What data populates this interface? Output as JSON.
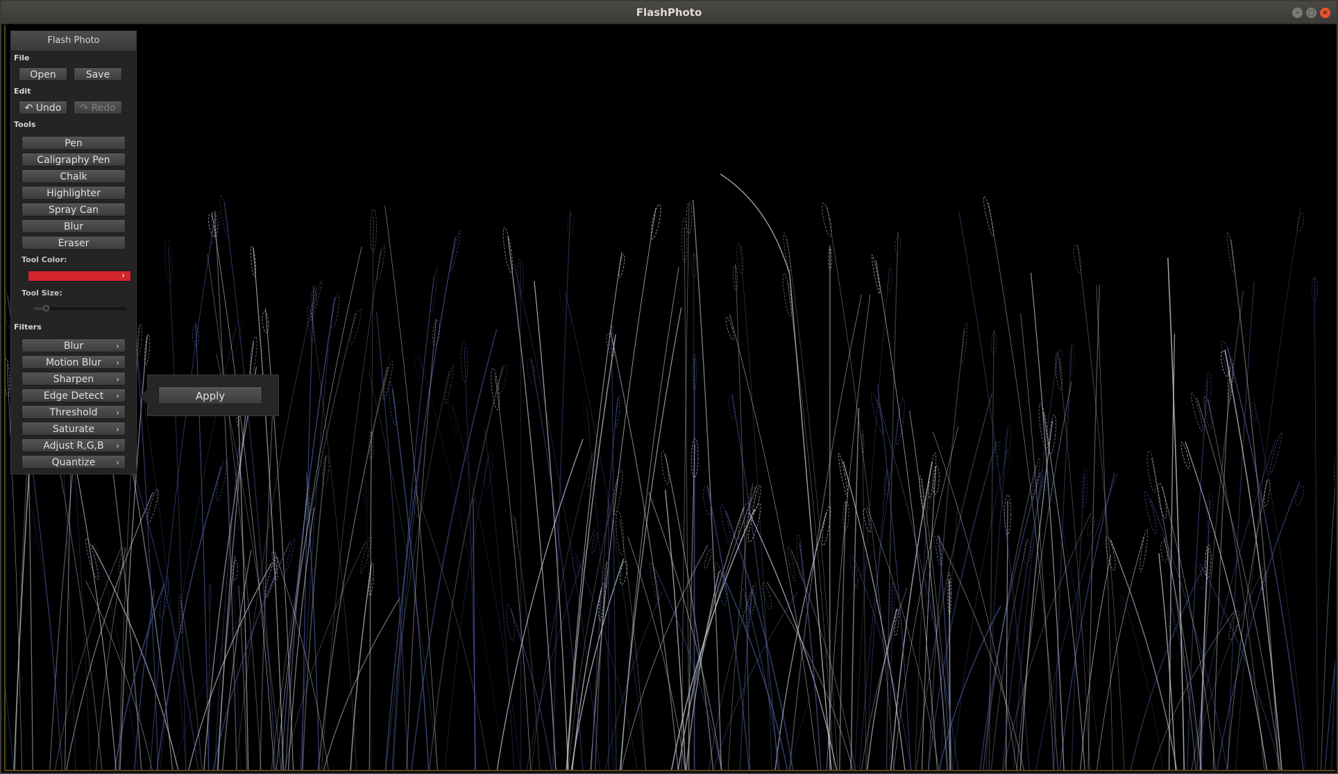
{
  "window": {
    "title": "FlashPhoto",
    "controls": {
      "minimize": "–",
      "maximize": "□",
      "close": "×"
    }
  },
  "panel": {
    "header": "Flash Photo",
    "file_label": "File",
    "open_label": "Open",
    "save_label": "Save",
    "edit_label": "Edit",
    "undo_label": "Undo",
    "redo_label": "Redo",
    "undo_icon": "↶",
    "redo_icon": "↷",
    "tools_label": "Tools",
    "tools": [
      "Pen",
      "Caligraphy Pen",
      "Chalk",
      "Highlighter",
      "Spray Can",
      "Blur",
      "Eraser"
    ],
    "tool_color_label": "Tool Color:",
    "tool_color": "#d1252b",
    "tool_size_label": "Tool Size:",
    "tool_size_fraction": 0.13,
    "filters_label": "Filters",
    "filters": [
      "Blur",
      "Motion Blur",
      "Sharpen",
      "Edge Detect",
      "Threshold",
      "Saturate",
      "Adjust R,G,B",
      "Quantize"
    ],
    "chevron": "›"
  },
  "popup": {
    "apply_label": "Apply"
  },
  "colors": {
    "canvas_bg": "#000000",
    "stem_light": "#c8cbd6",
    "stem_blue": "#4a5a9c",
    "accent_close": "#e9542b"
  }
}
